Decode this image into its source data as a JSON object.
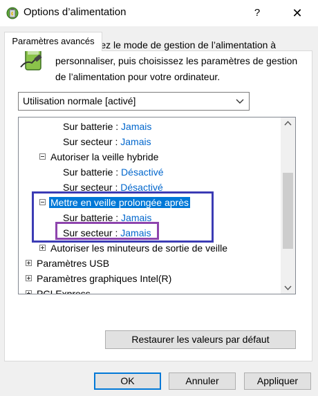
{
  "window": {
    "title": "Options d’alimentation",
    "help_label": "?",
    "close_label": "✕"
  },
  "tab": {
    "label": "Paramètres avancés"
  },
  "description": "Sélectionnez le mode de gestion de l’alimentation à personnaliser, puis choisissez les paramètres de gestion de l’alimentation pour votre ordinateur.",
  "plan_select": {
    "value": "Utilisation normale [activé]"
  },
  "tree": {
    "rows": [
      {
        "label": "Sur batterie :",
        "value": "Jamais"
      },
      {
        "label": "Sur secteur :",
        "value": "Jamais"
      },
      {
        "label": "Autoriser la veille hybride"
      },
      {
        "label": "Sur batterie :",
        "value": "Désactivé"
      },
      {
        "label": "Sur secteur :",
        "value": "Désactivé"
      },
      {
        "label": "Mettre en veille prolongée après"
      },
      {
        "label": "Sur batterie :",
        "value": "Jamais"
      },
      {
        "label": "Sur secteur :",
        "value": "Jamais"
      },
      {
        "label": "Autoriser les minuteurs de sortie de veille"
      },
      {
        "label": "Paramètres USB"
      },
      {
        "label": "Paramètres graphiques Intel(R)"
      },
      {
        "label": "PCI Express"
      }
    ]
  },
  "buttons": {
    "restore": "Restaurer les valeurs par défaut",
    "ok": "OK",
    "cancel": "Annuler",
    "apply": "Appliquer"
  },
  "colors": {
    "selection": "#0078d7",
    "link_value": "#0066cc",
    "highlight_outer": "#3b3bb4",
    "highlight_inner": "#8e44ad"
  }
}
